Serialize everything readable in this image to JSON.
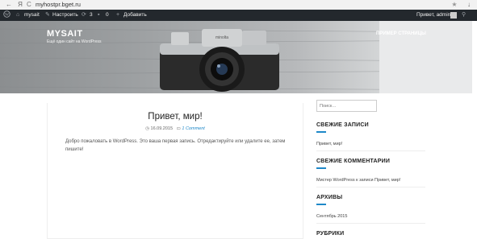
{
  "browser": {
    "url": "myhostpr.bget.ru",
    "icon_back": "←",
    "icon_ya": "Я",
    "icon_reload": "C",
    "icon_star": "★",
    "icon_download": "↓"
  },
  "admin_bar": {
    "site_name": "mysait",
    "customize": "Настроить",
    "updates_count": "3",
    "comments_count": "0",
    "add_new": "Добавить",
    "greeting": "Привет, admin"
  },
  "header": {
    "site_title": "MYSAIT",
    "site_description": "Ещё один сайт на WordPress",
    "menu_item": "ПРИМЕР СТРАНИЦЫ"
  },
  "post": {
    "title": "Привет, мир!",
    "date": "16.09.2015",
    "comments": "1 Comment",
    "body": "Добро пожаловать в WordPress. Это ваша первая запись. Отредактируйте или удалите ее, затем пишите!"
  },
  "sidebar": {
    "search_placeholder": "Поиск…",
    "recent_posts_title": "СВЕЖИЕ ЗАПИСИ",
    "recent_post": "Привет, мир!",
    "recent_comments_title": "СВЕЖИЕ КОММЕНТАРИИ",
    "recent_comment": "Мистер WordPress к записи Привет, мир!",
    "archives_title": "АРХИВЫ",
    "archive_item": "Сентябрь 2015",
    "categories_title": "РУБРИКИ"
  },
  "colors": {
    "accent": "#1e88c8",
    "admin_bar": "#23282d"
  }
}
